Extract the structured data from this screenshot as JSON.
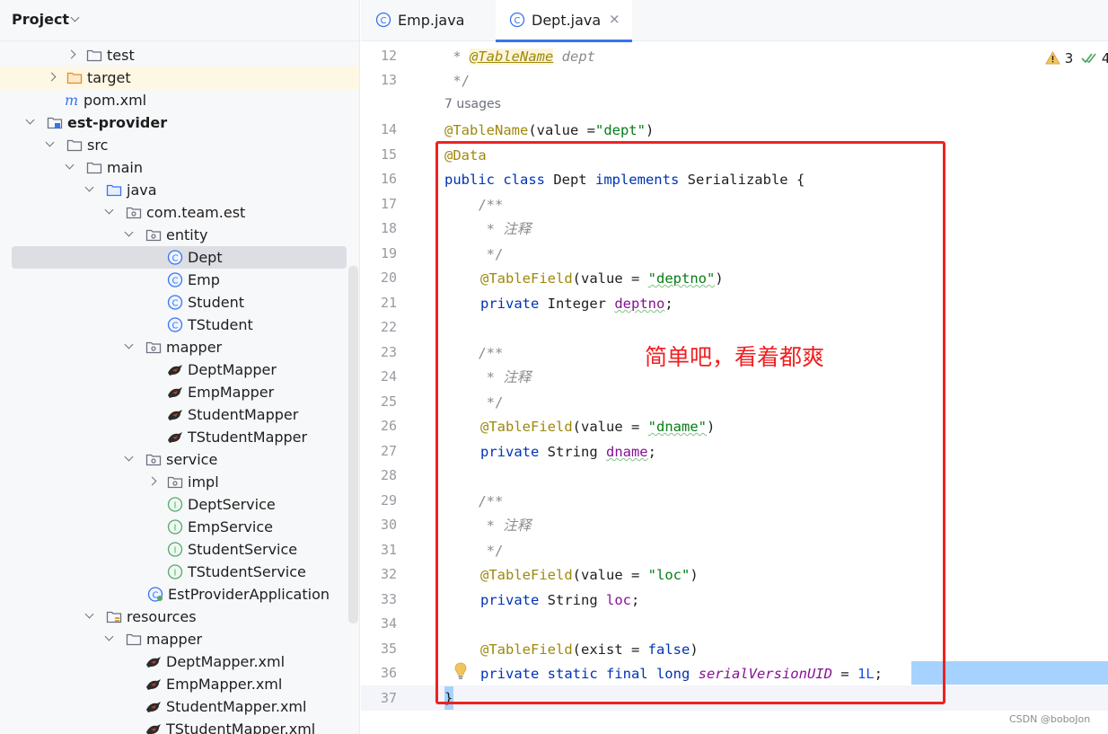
{
  "project_panel": {
    "title": "Project",
    "tree": [
      {
        "label": "test",
        "icon": "folder-icon",
        "chevron": "closed"
      },
      {
        "label": "target",
        "icon": "folder-orange-icon",
        "chevron": "closed",
        "highlight": "yellow"
      },
      {
        "label": "pom.xml",
        "icon": "maven-icon",
        "chevron": "none"
      },
      {
        "label": "est-provider",
        "icon": "module-folder-icon",
        "chevron": "open",
        "bold": true
      },
      {
        "label": "src",
        "icon": "folder-icon",
        "chevron": "open"
      },
      {
        "label": "main",
        "icon": "folder-icon",
        "chevron": "open"
      },
      {
        "label": "java",
        "icon": "source-folder-icon",
        "chevron": "open"
      },
      {
        "label": "com.team.est",
        "icon": "package-icon",
        "chevron": "open"
      },
      {
        "label": "entity",
        "icon": "package-icon",
        "chevron": "open"
      },
      {
        "label": "Dept",
        "icon": "class-icon",
        "chevron": "none",
        "selected": true
      },
      {
        "label": "Emp",
        "icon": "class-icon",
        "chevron": "none"
      },
      {
        "label": "Student",
        "icon": "class-icon",
        "chevron": "none"
      },
      {
        "label": "TStudent",
        "icon": "class-icon",
        "chevron": "none"
      },
      {
        "label": "mapper",
        "icon": "package-icon",
        "chevron": "open"
      },
      {
        "label": "DeptMapper",
        "icon": "mybatis-bird-icon",
        "chevron": "none"
      },
      {
        "label": "EmpMapper",
        "icon": "mybatis-bird-icon",
        "chevron": "none"
      },
      {
        "label": "StudentMapper",
        "icon": "mybatis-bird-icon",
        "chevron": "none"
      },
      {
        "label": "TStudentMapper",
        "icon": "mybatis-bird-icon",
        "chevron": "none"
      },
      {
        "label": "service",
        "icon": "package-icon",
        "chevron": "open"
      },
      {
        "label": "impl",
        "icon": "package-icon",
        "chevron": "closed"
      },
      {
        "label": "DeptService",
        "icon": "interface-icon",
        "chevron": "none"
      },
      {
        "label": "EmpService",
        "icon": "interface-icon",
        "chevron": "none"
      },
      {
        "label": "StudentService",
        "icon": "interface-icon",
        "chevron": "none"
      },
      {
        "label": "TStudentService",
        "icon": "interface-icon",
        "chevron": "none"
      },
      {
        "label": "EstProviderApplication",
        "icon": "spring-class-icon",
        "chevron": "none"
      },
      {
        "label": "resources",
        "icon": "resources-folder-icon",
        "chevron": "open"
      },
      {
        "label": "mapper",
        "icon": "folder-icon",
        "chevron": "open"
      },
      {
        "label": "DeptMapper.xml",
        "icon": "mybatis-bird-icon",
        "chevron": "none"
      },
      {
        "label": "EmpMapper.xml",
        "icon": "mybatis-bird-icon",
        "chevron": "none"
      },
      {
        "label": "StudentMapper.xml",
        "icon": "mybatis-bird-icon",
        "chevron": "none"
      },
      {
        "label": "TStudentMapper.xml",
        "icon": "mybatis-bird-icon",
        "chevron": "none"
      }
    ]
  },
  "tabs": [
    {
      "label": "Emp.java",
      "icon": "class-icon",
      "active": false
    },
    {
      "label": "Dept.java",
      "icon": "class-icon",
      "active": true,
      "close": "×"
    }
  ],
  "editor": {
    "inspections": {
      "warnings": "3",
      "checks": "4"
    },
    "usages_hint": "7 usages",
    "line_numbers": [
      "12",
      "13",
      "14",
      "15",
      "16",
      "17",
      "18",
      "19",
      "20",
      "21",
      "22",
      "23",
      "24",
      "25",
      "26",
      "27",
      "28",
      "29",
      "30",
      "31",
      "32",
      "33",
      "34",
      "35",
      "36",
      "37"
    ],
    "code": {
      "l12_star": " * ",
      "l12_ann": "@TableName",
      "l12_rest": " dept",
      "l13": " */",
      "l14_ann": "@TableName",
      "l14_a": "(value =",
      "l14_str": "\"dept\"",
      "l14_b": ")",
      "l15_ann": "@Data",
      "l16_kw1": "public class",
      "l16_a": " Dept ",
      "l16_kw2": "implements",
      "l16_b": " Serializable {",
      "l17": "    /**",
      "l18": "     * 注释",
      "l19": "     */",
      "l20_ann": "@TableField",
      "l20_a": "(value = ",
      "l20_str": "\"deptno\"",
      "l20_b": ")",
      "l21_kw": "private",
      "l21_a": " Integer ",
      "l21_fld": "deptno",
      "l21_b": ";",
      "l23": "    /**",
      "l24": "     * 注释",
      "l25": "     */",
      "l26_ann": "@TableField",
      "l26_a": "(value = ",
      "l26_str": "\"dname\"",
      "l26_b": ")",
      "l27_kw": "private",
      "l27_a": " String ",
      "l27_fld": "dname",
      "l27_b": ";",
      "l29": "    /**",
      "l30": "     * 注释",
      "l31": "     */",
      "l32_ann": "@TableField",
      "l32_a": "(value = ",
      "l32_str": "\"loc\"",
      "l32_b": ")",
      "l33_kw": "private",
      "l33_a": " String ",
      "l33_fld": "loc",
      "l33_b": ";",
      "l35_ann": "@TableField",
      "l35_a": "(exist = ",
      "l35_kw": "false",
      "l35_b": ")",
      "l36_kw": "private static final long",
      "l36_fld": "serialVersionUID",
      "l36_a": " = ",
      "l36_num": "1L",
      "l36_b": ";",
      "l37": "}"
    }
  },
  "annotation_text": "简单吧，看着都爽",
  "watermark": "CSDN @boboJon",
  "colors": {
    "accent": "#3574f0",
    "annotation_red": "#ee2222",
    "keyword": "#0033b3",
    "annotation": "#9e880d",
    "string": "#067d17",
    "field": "#871094"
  }
}
